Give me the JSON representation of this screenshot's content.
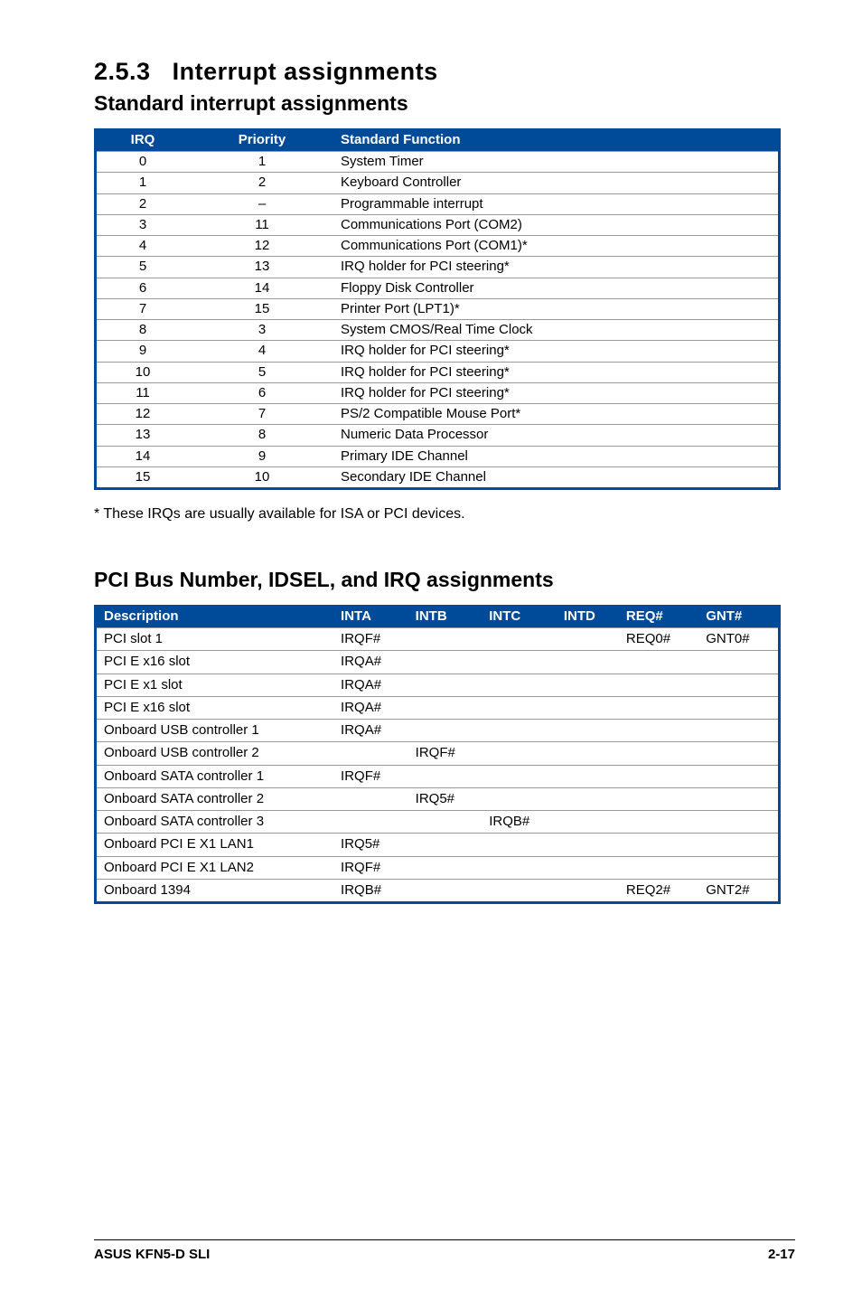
{
  "section_number": "2.5.3",
  "section_title": "Interrupt assignments",
  "sub1_title": "Standard interrupt assignments",
  "table1": {
    "headers": [
      "IRQ",
      "Priority",
      "Standard Function"
    ],
    "rows": [
      [
        "0",
        "1",
        "System Timer"
      ],
      [
        "1",
        "2",
        "Keyboard Controller"
      ],
      [
        "2",
        "–",
        "Programmable interrupt"
      ],
      [
        "3",
        "11",
        "Communications Port (COM2)"
      ],
      [
        "4",
        "12",
        "Communications Port (COM1)*"
      ],
      [
        "5",
        "13",
        "IRQ holder for PCI steering*"
      ],
      [
        "6",
        "14",
        "Floppy Disk Controller"
      ],
      [
        "7",
        "15",
        "Printer Port (LPT1)*"
      ],
      [
        "8",
        "3",
        "System CMOS/Real Time Clock"
      ],
      [
        "9",
        "4",
        "IRQ holder for PCI steering*"
      ],
      [
        "10",
        "5",
        "IRQ holder for PCI steering*"
      ],
      [
        "11",
        "6",
        "IRQ holder for PCI steering*"
      ],
      [
        "12",
        "7",
        "PS/2 Compatible Mouse Port*"
      ],
      [
        "13",
        "8",
        "Numeric Data Processor"
      ],
      [
        "14",
        "9",
        "Primary IDE Channel"
      ],
      [
        "15",
        "10",
        "Secondary IDE Channel"
      ]
    ]
  },
  "footnote": "* These IRQs are usually available for ISA or PCI devices.",
  "sub2_title": "PCI Bus Number, IDSEL, and IRQ assignments",
  "table2": {
    "headers": [
      "Description",
      "INTA",
      "INTB",
      "INTC",
      "INTD",
      "REQ#",
      "GNT#"
    ],
    "rows": [
      [
        "PCI slot 1",
        "IRQF#",
        "",
        "",
        "",
        "REQ0#",
        "GNT0#"
      ],
      [
        "PCI E x16 slot",
        "IRQA#",
        "",
        "",
        "",
        "",
        ""
      ],
      [
        "PCI E x1 slot",
        "IRQA#",
        "",
        "",
        "",
        "",
        ""
      ],
      [
        "PCI E x16 slot",
        "IRQA#",
        "",
        "",
        "",
        "",
        ""
      ],
      [
        "Onboard USB controller 1",
        "IRQA#",
        "",
        "",
        "",
        "",
        ""
      ],
      [
        "Onboard USB controller 2",
        "",
        "IRQF#",
        "",
        "",
        "",
        ""
      ],
      [
        "Onboard SATA controller 1",
        "IRQF#",
        "",
        "",
        "",
        "",
        ""
      ],
      [
        "Onboard SATA controller 2",
        "",
        "IRQ5#",
        "",
        "",
        "",
        ""
      ],
      [
        "Onboard SATA controller 3",
        "",
        "",
        "IRQB#",
        "",
        "",
        ""
      ],
      [
        "Onboard PCI E X1 LAN1",
        "IRQ5#",
        "",
        "",
        "",
        "",
        ""
      ],
      [
        "Onboard PCI E X1 LAN2",
        "IRQF#",
        "",
        "",
        "",
        "",
        ""
      ],
      [
        "Onboard 1394",
        "IRQB#",
        "",
        "",
        "",
        "REQ2#",
        "GNT2#"
      ]
    ]
  },
  "footer_left": "ASUS KFN5-D SLI",
  "footer_right": "2-17"
}
